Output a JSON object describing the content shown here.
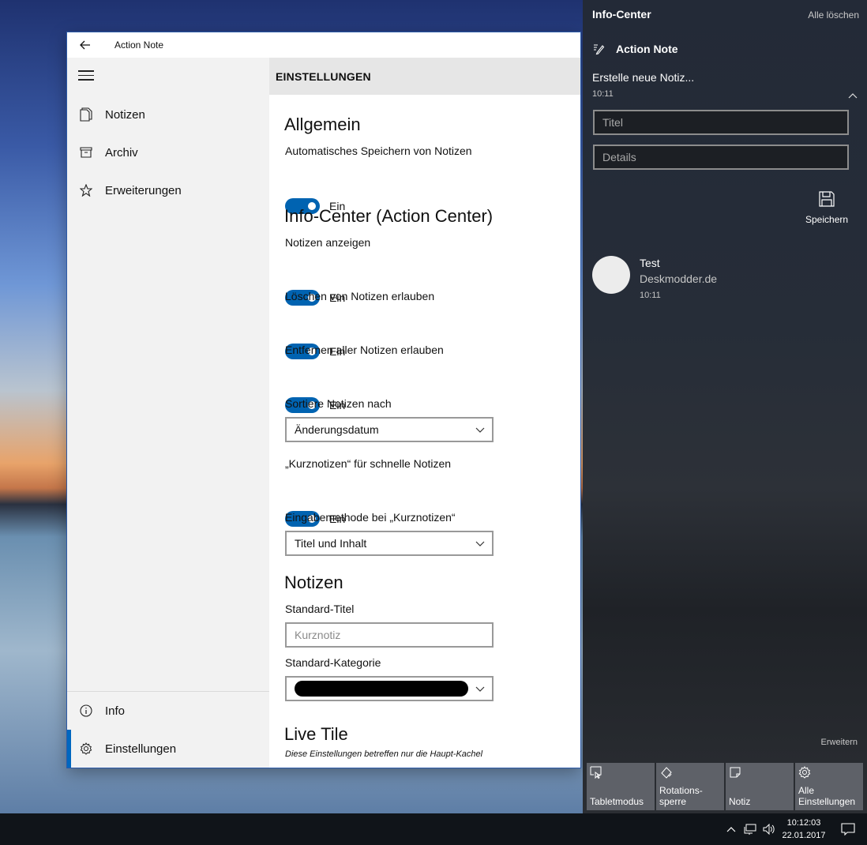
{
  "app": {
    "title": "Action Note",
    "nav": {
      "items": [
        {
          "label": "Notizen",
          "icon": "notes-icon"
        },
        {
          "label": "Archiv",
          "icon": "archive-icon"
        },
        {
          "label": "Erweiterungen",
          "icon": "star-icon"
        }
      ],
      "bottom": [
        {
          "label": "Info",
          "icon": "info-icon"
        },
        {
          "label": "Einstellungen",
          "icon": "gear-icon"
        }
      ]
    },
    "header": "EINSTELLUNGEN",
    "general": {
      "title": "Allgemein",
      "autosave_label": "Automatisches Speichern von Notizen",
      "autosave_state": "Ein"
    },
    "infocenter": {
      "title": "Info-Center (Action Center)",
      "show_label": "Notizen anzeigen",
      "show_state": "Ein",
      "delete_label": "Löschen von Notizen erlauben",
      "delete_state": "Ein",
      "remove_all_label": "Entfernen aller Notizen erlauben",
      "remove_all_state": "Ein",
      "sort_label": "Sortiere Notizen nach",
      "sort_value": "Änderungsdatum",
      "quick_label": "„Kurznotizen“ für schnelle Notizen",
      "quick_state": "Ein",
      "input_method_label": "Eingabemethode bei „Kurznotizen“",
      "input_method_value": "Titel und Inhalt"
    },
    "notes": {
      "title": "Notizen",
      "default_title_label": "Standard-Titel",
      "default_title_placeholder": "Kurznotiz",
      "default_category_label": "Standard-Kategorie"
    },
    "livetile": {
      "title": "Live Tile",
      "note": "Diese Einstellungen betreffen nur die Haupt-Kachel"
    }
  },
  "action_center": {
    "title": "Info-Center",
    "clear_all": "Alle löschen",
    "app_name": "Action Note",
    "notif_title": "Erstelle neue Notiz...",
    "notif_time": "10:11",
    "title_placeholder": "Titel",
    "details_placeholder": "Details",
    "save_label": "Speichern",
    "card": {
      "title": "Test",
      "subtitle": "Deskmodder.de",
      "time": "10:11"
    },
    "expand": "Erweitern",
    "quick_actions": [
      {
        "label": "Tabletmodus"
      },
      {
        "label": "Rotations-\nsperre"
      },
      {
        "label": "Notiz"
      },
      {
        "label": "Alle\nEinstellungen"
      }
    ]
  },
  "taskbar": {
    "time": "10:12:03",
    "date": "22.01.2017"
  },
  "colors": {
    "accent": "#0063b1",
    "sidebar_bg": "#f2f2f2",
    "action_center_bg": "#262d38"
  }
}
